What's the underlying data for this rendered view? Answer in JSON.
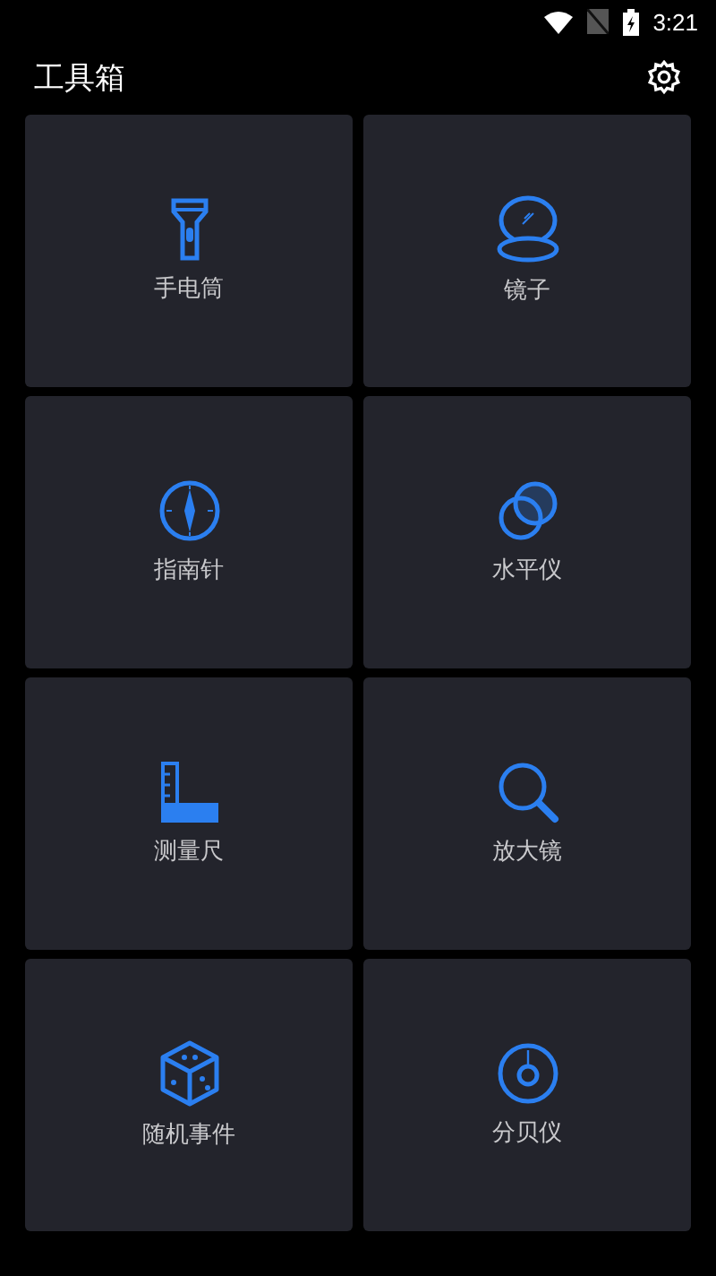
{
  "status_bar": {
    "time": "3:21"
  },
  "app_bar": {
    "title": "工具箱"
  },
  "tools": [
    {
      "label": "手电筒",
      "kind": "flashlight"
    },
    {
      "label": "镜子",
      "kind": "mirror"
    },
    {
      "label": "指南针",
      "kind": "compass"
    },
    {
      "label": "水平仪",
      "kind": "level"
    },
    {
      "label": "测量尺",
      "kind": "ruler"
    },
    {
      "label": "放大镜",
      "kind": "magnifier"
    },
    {
      "label": "随机事件",
      "kind": "dice"
    },
    {
      "label": "分贝仪",
      "kind": "decibel"
    }
  ]
}
